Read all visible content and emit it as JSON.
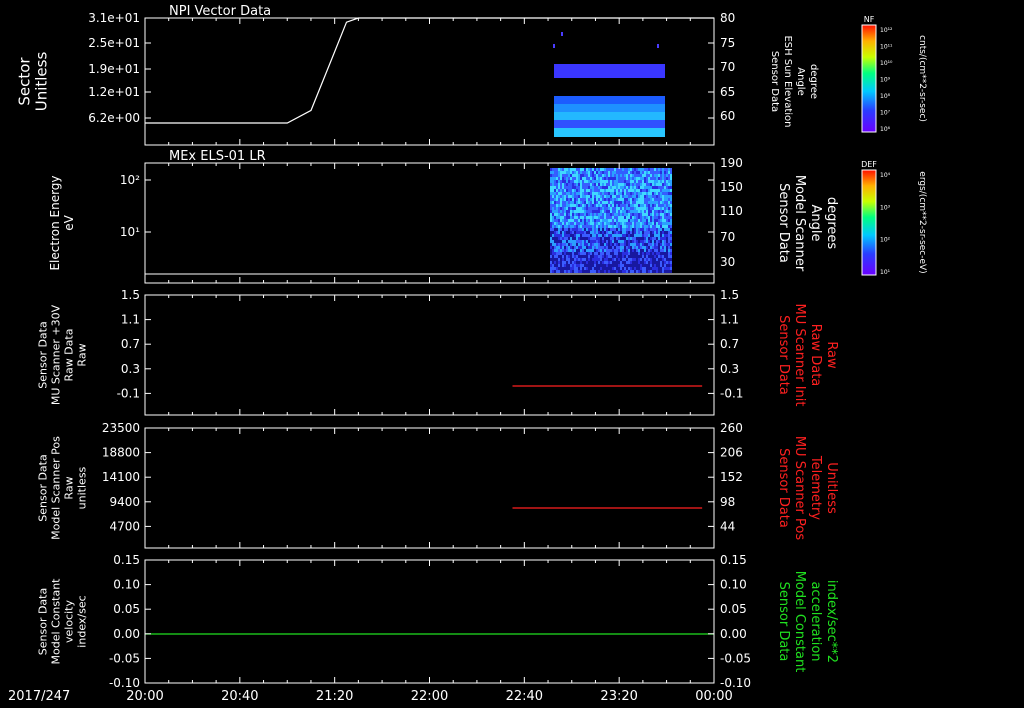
{
  "date_label": "2017/247",
  "x_ticks": [
    "20:00",
    "20:40",
    "21:20",
    "22:00",
    "22:40",
    "23:20",
    "00:00"
  ],
  "colors": {
    "axis": "#ffffff",
    "red_trace": "#ff2020",
    "green_trace": "#20e020",
    "blue_spec": "#3040ff",
    "cyan_spec": "#30c0ff"
  },
  "chart_data": [
    {
      "type": "line+heatmap",
      "panel_title": "NPI Vector Data",
      "ylabel": [
        "Sector",
        "Unitless"
      ],
      "y_ticks": [
        "3.1e+01",
        "2.5e+01",
        "1.9e+01",
        "1.2e+01",
        "6.2e+00"
      ],
      "right_ylabel": [
        "Sensor Data",
        "ESH Sun Elevation",
        "Angle",
        "degree"
      ],
      "right_ticks": [
        "80",
        "75",
        "70",
        "65",
        "60"
      ],
      "series": [
        {
          "x": [
            "20:00",
            "20:40",
            "21:00",
            "21:10",
            "21:20",
            "21:25",
            "21:30",
            "24:00"
          ],
          "y": [
            55,
            55,
            55,
            58,
            72,
            79,
            80,
            80
          ]
        }
      ],
      "colorbar": {
        "label": "NF",
        "unit": "cnts/(cm**2-sr-sec)",
        "ticks": [
          "10¹²",
          "10¹¹",
          "10¹⁰",
          "10⁹",
          "10⁸",
          "10⁷",
          "10⁶"
        ]
      }
    },
    {
      "type": "heatmap",
      "panel_title": "MEx ELS-01 LR",
      "ylabel": [
        "Electron Energy",
        "eV"
      ],
      "y_ticks": [
        "10²",
        "10¹"
      ],
      "right_ylabel": [
        "Sensor Data",
        "Model Scanner",
        "Angle",
        "degrees"
      ],
      "right_ticks": [
        "190",
        "150",
        "110",
        "70",
        "30"
      ],
      "colorbar": {
        "label": "DEF",
        "unit": "ergs/(cm**2-sr-sec-eV)",
        "ticks": [
          "10⁴",
          "10³",
          "10²",
          "10¹"
        ]
      }
    },
    {
      "type": "line",
      "ylabel": [
        "Sensor Data",
        "MU Scanner +30V",
        "Raw Data",
        "Raw"
      ],
      "y_ticks": [
        "1.5",
        "1.1",
        "0.7",
        "0.3",
        "-0.1"
      ],
      "right_ylabel": [
        "Sensor Data",
        "MU Scanner Init",
        "Raw Data",
        "Raw"
      ],
      "right_ticks": [
        "1.5",
        "1.1",
        "0.7",
        "0.3",
        "-0.1"
      ],
      "series": [
        {
          "x": [
            "22:35",
            "23:55"
          ],
          "y": [
            0.0,
            0.0
          ]
        }
      ]
    },
    {
      "type": "line",
      "ylabel": [
        "Sensor Data",
        "Model Scanner Pos",
        "Raw",
        "unitless"
      ],
      "y_ticks": [
        "23500",
        "18800",
        "14100",
        "9400",
        "4700"
      ],
      "right_ylabel": [
        "Sensor Data",
        "MU Scanner Pos",
        "Telemetry",
        "Unitless"
      ],
      "right_ticks": [
        "260",
        "206",
        "152",
        "98",
        "44"
      ],
      "series": [
        {
          "x": [
            "22:35",
            "23:55"
          ],
          "y": [
            8100,
            8100
          ]
        }
      ]
    },
    {
      "type": "line",
      "ylabel": [
        "Sensor Data",
        "Model Constant",
        "velocity",
        "index/sec"
      ],
      "y_ticks": [
        "0.15",
        "0.10",
        "0.05",
        "0.00",
        "-0.05",
        "-0.10"
      ],
      "right_ylabel": [
        "Sensor Data",
        "Model Constant",
        "acceleration",
        "index/sec**2"
      ],
      "right_ticks": [
        "0.15",
        "0.10",
        "0.05",
        "0.00",
        "-0.05",
        "-0.10"
      ],
      "series": [
        {
          "x": [
            "20:00",
            "24:00"
          ],
          "y": [
            0.0,
            0.0
          ]
        }
      ]
    }
  ]
}
